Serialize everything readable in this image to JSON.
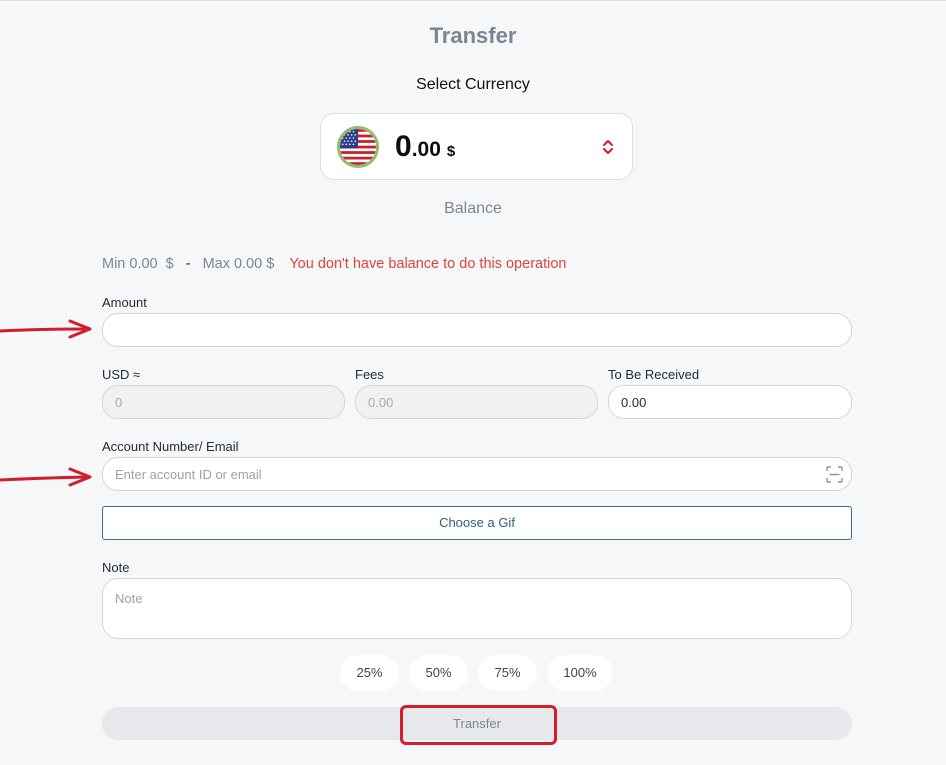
{
  "page": {
    "title": "Transfer",
    "select_currency_label": "Select Currency",
    "balance_caption": "Balance"
  },
  "currency": {
    "flag_icon": "us-flag-icon",
    "balance_int": "0",
    "balance_dec": ".00",
    "currency_symbol": "$",
    "toggle_icon": "chevron-up-down-icon"
  },
  "limits": {
    "min_text": "Min 0.00  $",
    "separator": "-",
    "max_text": "Max 0.00 $",
    "error_text": "You don't have balance to do this operation",
    "error_color": "#e0443a"
  },
  "amount": {
    "label": "Amount",
    "value": "",
    "placeholder": ""
  },
  "conversion": {
    "usd_label": "USD ≈",
    "usd_value": "0",
    "fees_label": "Fees",
    "fees_value": "0.00",
    "received_label": "To Be Received",
    "received_value": "0.00"
  },
  "account": {
    "label": "Account Number/ Email",
    "placeholder": "Enter account ID or email",
    "scan_icon": "qr-scan-icon"
  },
  "gif": {
    "button_label": "Choose a Gif"
  },
  "note": {
    "label": "Note",
    "placeholder": "Note"
  },
  "percentages": [
    "25%",
    "50%",
    "75%",
    "100%"
  ],
  "submit": {
    "label": "Transfer"
  },
  "annotations": {
    "color": "#d01f2c"
  }
}
